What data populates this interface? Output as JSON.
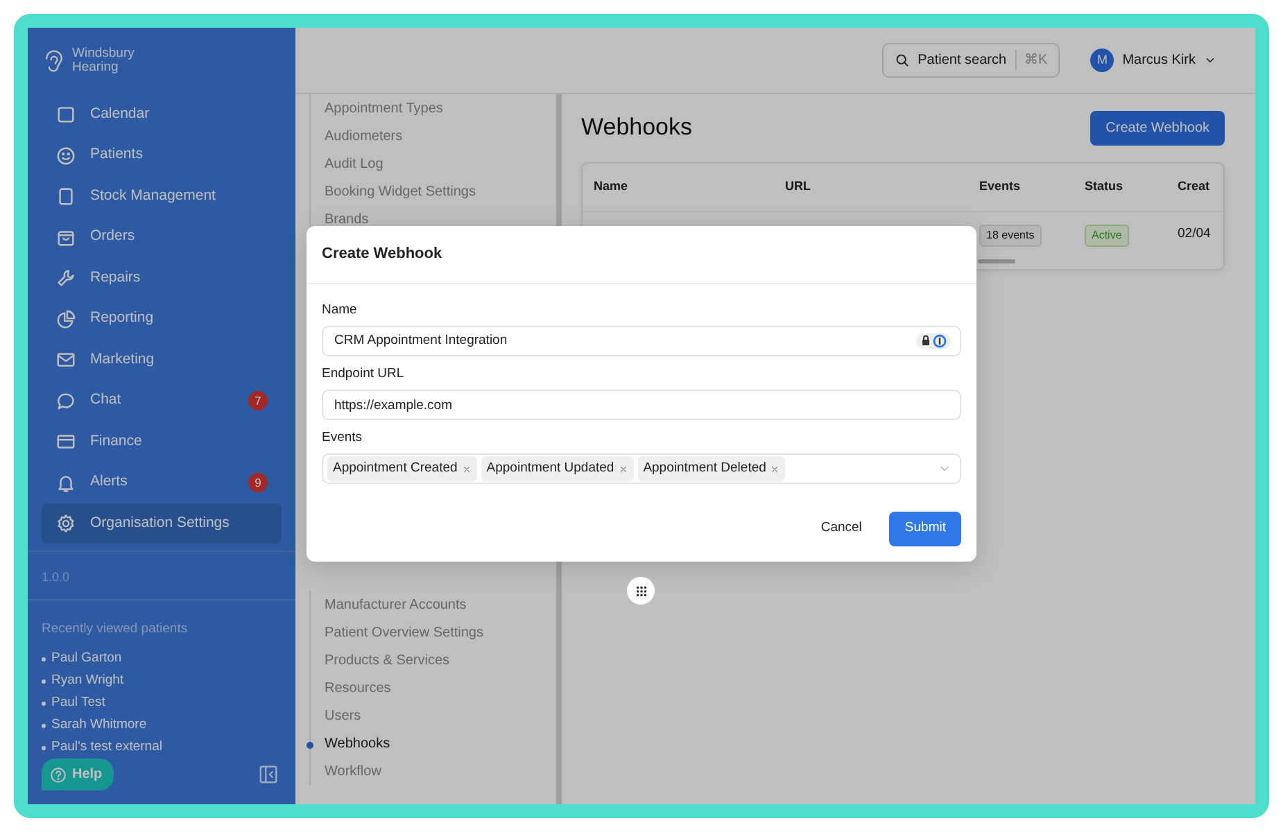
{
  "brand": {
    "line1": "Windsbury",
    "line2": "Hearing"
  },
  "sidebar": {
    "items": [
      {
        "label": "Calendar",
        "selected": false
      },
      {
        "label": "Patients",
        "selected": false
      },
      {
        "label": "Stock Management",
        "selected": false
      },
      {
        "label": "Orders",
        "selected": false
      },
      {
        "label": "Repairs",
        "selected": false
      },
      {
        "label": "Reporting",
        "selected": false
      },
      {
        "label": "Marketing",
        "selected": false
      },
      {
        "label": "Chat",
        "selected": false,
        "badge": "7"
      },
      {
        "label": "Finance",
        "selected": false
      },
      {
        "label": "Alerts",
        "selected": false,
        "badge": "9"
      },
      {
        "label": "Organisation Settings",
        "selected": true
      }
    ],
    "version": "1.0.0",
    "recent_title": "Recently viewed patients",
    "recent_patients": [
      "Paul Garton",
      "Ryan Wright",
      "Paul Test",
      "Sarah Whitmore",
      "Paul's test external"
    ],
    "help_button": "Help"
  },
  "topbar": {
    "search_label": "Patient search",
    "shortcut": "⌘K",
    "user_initial": "M",
    "user_name": "Marcus Kirk"
  },
  "settings_nav": {
    "upper_items": [
      {
        "label": "Appointment Types",
        "selected": false
      },
      {
        "label": "Audiometers",
        "selected": false
      },
      {
        "label": "Audit Log",
        "selected": false
      },
      {
        "label": "Booking Widget Settings",
        "selected": false
      },
      {
        "label": "Brands",
        "selected": false
      }
    ],
    "lower_items": [
      {
        "label": "Manufacturer Accounts",
        "selected": false
      },
      {
        "label": "Patient Overview Settings",
        "selected": false
      },
      {
        "label": "Products & Services",
        "selected": false
      },
      {
        "label": "Resources",
        "selected": false
      },
      {
        "label": "Users",
        "selected": false
      },
      {
        "label": "Webhooks",
        "selected": true
      },
      {
        "label": "Workflow",
        "selected": false
      }
    ]
  },
  "page": {
    "title": "Webhooks",
    "create_button": "Create Webhook",
    "table": {
      "columns": [
        "Name",
        "URL",
        "Events",
        "Status",
        "Creat"
      ],
      "rows": [
        {
          "events": "18 events",
          "status": "Active",
          "created": "02/04"
        }
      ]
    }
  },
  "modal": {
    "title": "Create Webhook",
    "fields": [
      {
        "kind": "text",
        "label": "Name",
        "value": "CRM Appointment Integration",
        "autofill_icon": true
      },
      {
        "kind": "text",
        "label": "Endpoint URL",
        "value": "https://example.com",
        "autofill_icon": false
      },
      {
        "kind": "multiselect",
        "label": "Events",
        "tags": [
          "Appointment Created",
          "Appointment Updated",
          "Appointment Deleted"
        ]
      }
    ],
    "cancel_button": "Cancel",
    "submit_button": "Submit"
  }
}
